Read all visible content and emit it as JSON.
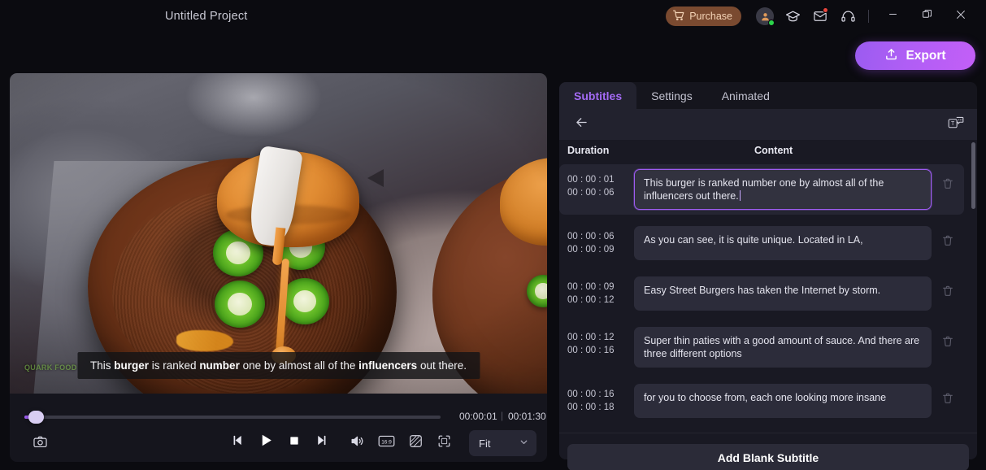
{
  "titlebar": {
    "project_title": "Untitled Project",
    "purchase_label": "Purchase",
    "icons": {
      "cart": "cart-icon",
      "avatar": "avatar-icon",
      "tutorials": "graduation-cap-icon",
      "mail": "mail-icon",
      "support": "headset-icon",
      "minimize": "minimize-icon",
      "maximize": "maximize-icon",
      "close": "close-icon"
    }
  },
  "export": {
    "label": "Export",
    "icon": "upload-icon"
  },
  "player": {
    "current_time": "00:00:01",
    "total_time": "00:01:30",
    "time_separator": "|",
    "progress_percent": 2,
    "fit_label": "Fit",
    "subtitle_overlay": {
      "parts": [
        {
          "text": "This ",
          "bold": false
        },
        {
          "text": "burger",
          "bold": true
        },
        {
          "text": " is ranked ",
          "bold": false
        },
        {
          "text": "number",
          "bold": true
        },
        {
          "text": " one by almost all of the ",
          "bold": false
        },
        {
          "text": "influencers",
          "bold": true
        },
        {
          "text": " out there.",
          "bold": false
        }
      ]
    },
    "watermark": "QUARK FOOD",
    "controls": {
      "snapshot": "camera-icon",
      "prev_frame": "previous-frame-icon",
      "play": "play-icon",
      "stop": "stop-icon",
      "next_frame": "next-frame-icon",
      "volume": "volume-icon",
      "aspect_ratio": "16:9",
      "mask": "mask-icon",
      "fullscreen": "fullscreen-icon"
    }
  },
  "panel": {
    "tabs": [
      {
        "label": "Subtitles",
        "active": true
      },
      {
        "label": "Settings",
        "active": false
      },
      {
        "label": "Animated",
        "active": false
      }
    ],
    "toolbar": {
      "back": "back-arrow-icon",
      "batch_edit": "text-batch-edit-icon"
    },
    "columns": {
      "duration": "Duration",
      "content": "Content"
    },
    "rows": [
      {
        "start": "00 : 00 : 01",
        "end": "00 : 00 : 06",
        "text": "This burger is ranked number one by almost all of the influencers out there.",
        "selected": true
      },
      {
        "start": "00 : 00 : 06",
        "end": "00 : 00 : 09",
        "text": "As you can see, it is quite unique. Located in LA,",
        "selected": false
      },
      {
        "start": "00 : 00 : 09",
        "end": "00 : 00 : 12",
        "text": "Easy Street Burgers has taken the Internet by storm.",
        "selected": false
      },
      {
        "start": "00 : 00 : 12",
        "end": "00 : 00 : 16",
        "text": "Super thin paties with a good amount of sauce. And there are three different options",
        "selected": false
      },
      {
        "start": "00 : 00 : 16",
        "end": "00 : 00 : 18",
        "text": "for you to choose from, each one looking more insane",
        "selected": false
      }
    ],
    "add_blank_label": "Add Blank Subtitle"
  },
  "colors": {
    "accent_purple": "#9d5cf0",
    "tab_active": "#a46bf5",
    "purchase_bg": "#7a4a30",
    "export_gradient_start": "#9b5cf0",
    "export_gradient_end": "#c35ff7",
    "panel_bg": "#191923",
    "app_bg": "#0b0b10",
    "online_dot": "#2bd44a",
    "notification_dot": "#e8453c"
  }
}
